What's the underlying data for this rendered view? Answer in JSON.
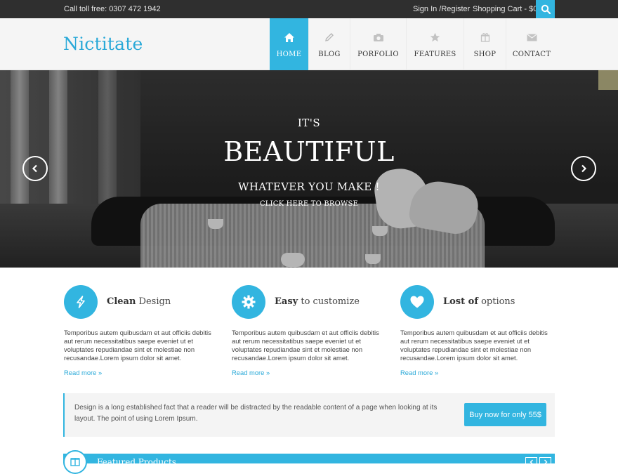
{
  "topbar": {
    "call": "Call toll free: 0307 472 1942",
    "signin": "Sign In /Register",
    "cart": "Shopping Cart - $0"
  },
  "header": {
    "logo": "Nictitate",
    "nav": [
      {
        "label": "HOME",
        "icon": "home-icon",
        "active": true
      },
      {
        "label": "BLOG",
        "icon": "pencil-icon"
      },
      {
        "label": "PORFOLIO",
        "icon": "camera-icon"
      },
      {
        "label": "FEATURES",
        "icon": "star-icon"
      },
      {
        "label": "SHOP",
        "icon": "gift-icon"
      },
      {
        "label": "CONTACT",
        "icon": "envelope-icon"
      }
    ]
  },
  "hero": {
    "line1": "IT'S",
    "line2": "BEAUTIFUL",
    "line3": "WHATEVER YOU MAKE !",
    "cta": "CLICK HERE TO BROWSE"
  },
  "features": [
    {
      "title_bold": "Clean",
      "title_rest": " Design",
      "icon": "bolt-icon",
      "text": "Temporibus autem quibusdam et aut officiis debitis aut rerum necessitatibus saepe eveniet ut et voluptates repudiandae sint et molestiae non recusandae.Lorem ipsum dolor sit amet.",
      "more": "Read more »"
    },
    {
      "title_bold": "Easy",
      "title_rest": " to customize",
      "icon": "gear-icon",
      "text": "Temporibus autem quibusdam et aut officiis debitis aut rerum necessitatibus saepe eveniet ut et voluptates repudiandae sint et molestiae non recusandae.Lorem ipsum dolor sit amet.",
      "more": "Read more »"
    },
    {
      "title_bold": "Lost of",
      "title_rest": " options",
      "icon": "heart-icon",
      "text": "Temporibus autem quibusdam et aut officiis debitis aut rerum necessitatibus saepe eveniet ut et voluptates repudiandae sint et molestiae non recusandae.Lorem ipsum dolor sit amet.",
      "more": "Read more »"
    }
  ],
  "callout": {
    "text": "Design is a long established fact that a reader will be distracted by the readable content of a page when looking at its layout. The point of using Lorem Ipsum.",
    "button": "Buy now for only 55$"
  },
  "featured": {
    "title": "Featured Products"
  },
  "colors": {
    "accent": "#32b5e0",
    "topbar": "#2f2f2f"
  }
}
